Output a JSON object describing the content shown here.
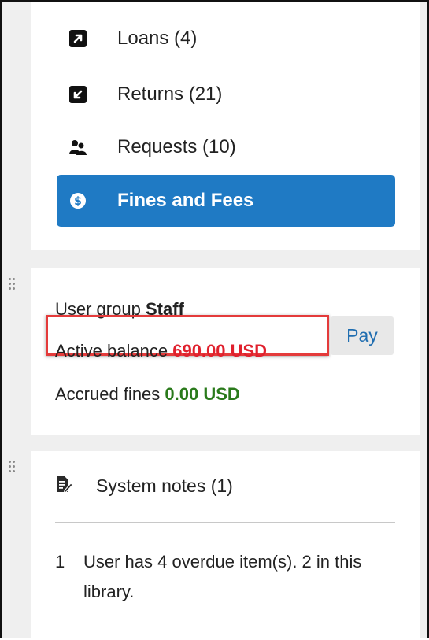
{
  "nav": {
    "items": [
      {
        "label": "Loans (4)",
        "icon": "arrow-up-right-square-icon"
      },
      {
        "label": "Returns (21)",
        "icon": "arrow-down-left-square-icon"
      },
      {
        "label": "Requests (10)",
        "icon": "users-request-icon"
      },
      {
        "label": "Fines and Fees",
        "icon": "dollar-circle-icon",
        "active": true
      }
    ]
  },
  "info": {
    "user_group_label": "User group",
    "user_group_value": "Staff",
    "active_balance_label": "Active balance",
    "active_balance_value": "690.00 USD",
    "pay_label": "Pay",
    "accrued_fines_label": "Accrued fines",
    "accrued_fines_value": "0.00 USD"
  },
  "notes": {
    "title": "System notes (1)",
    "items": [
      {
        "num": "1",
        "text": "User has 4 overdue item(s). 2 in this library."
      }
    ]
  },
  "colors": {
    "accent": "#1f7ac4",
    "balance": "#e0202d",
    "fines": "#2a7a1b",
    "highlight": "#e43b3b"
  }
}
